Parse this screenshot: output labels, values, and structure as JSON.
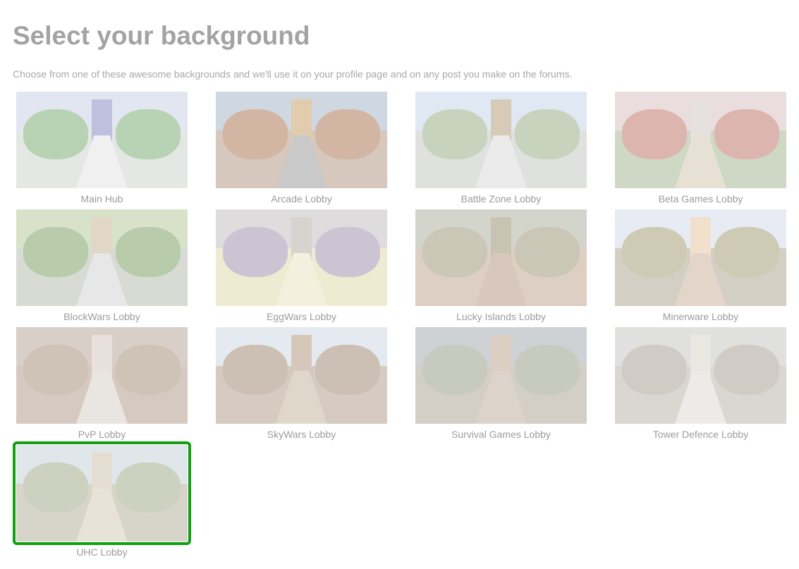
{
  "header": {
    "title": "Select your background",
    "subtitle": "Choose from one of these awesome backgrounds and we'll use it on your profile page and on any post you make on the forums."
  },
  "selected_index": 12,
  "accent_color": "#10a010",
  "backgrounds": [
    {
      "label": "Main Hub",
      "sky": "#c9d2e4",
      "ground": "#cfd6d0",
      "path": "#e4e4e4",
      "tree": "#7fae78",
      "tower": "#8a8fc2"
    },
    {
      "label": "Arcade Lobby",
      "sky": "#a8b7c9",
      "ground": "#b69c86",
      "path": "#9e9e9e",
      "tree": "#b07a58",
      "tower": "#c9a36c"
    },
    {
      "label": "Battle Zone Lobby",
      "sky": "#c8d6ec",
      "ground": "#c5c9c6",
      "path": "#dcdcdc",
      "tree": "#9ab086",
      "tower": "#b8a07e"
    },
    {
      "label": "Beta Games Lobby",
      "sky": "#d8c4c2",
      "ground": "#a8b896",
      "path": "#d4cab4",
      "tree": "#c07a6e",
      "tower": "#d4c8c8"
    },
    {
      "label": "BlockWars Lobby",
      "sky": "#b8cc9e",
      "ground": "#b8bfb2",
      "path": "#d4d4d4",
      "tree": "#7fa46a",
      "tower": "#c9b89a"
    },
    {
      "label": "EggWars Lobby",
      "sky": "#c6c0c2",
      "ground": "#e2dcae",
      "path": "#ece4c4",
      "tree": "#a694b0",
      "tower": "#b8b0a8"
    },
    {
      "label": "Lucky Islands Lobby",
      "sky": "#b0b4a4",
      "ground": "#c2a894",
      "path": "#b89a86",
      "tree": "#a09a7c",
      "tower": "#9c9478"
    },
    {
      "label": "Minerware Lobby",
      "sky": "#d2dcec",
      "ground": "#b2a896",
      "path": "#cdb39e",
      "tree": "#a8a078",
      "tower": "#e6c8a4"
    },
    {
      "label": "PvP Lobby",
      "sky": "#b8a89c",
      "ground": "#b6a08e",
      "path": "#d8d0c8",
      "tree": "#a8927e",
      "tower": "#d4c8c0"
    },
    {
      "label": "SkyWars Lobby",
      "sky": "#d0d8e4",
      "ground": "#b4a28e",
      "path": "#c8b7a2",
      "tree": "#a48e78",
      "tower": "#b49c84"
    },
    {
      "label": "Survival Games Lobby",
      "sky": "#a8aeb4",
      "ground": "#b2a898",
      "path": "#c0b2a2",
      "tree": "#98a08c",
      "tower": "#bca890"
    },
    {
      "label": "Tower Defence Lobby",
      "sky": "#c8c8c4",
      "ground": "#bcb6ac",
      "path": "#e0dcd4",
      "tree": "#aaa296",
      "tower": "#d8d4cc"
    },
    {
      "label": "UHC Lobby",
      "sky": "#c8d4dc",
      "ground": "#b8b2a0",
      "path": "#d6cdb8",
      "tree": "#a4ae8c",
      "tower": "#cfc2ac"
    }
  ]
}
